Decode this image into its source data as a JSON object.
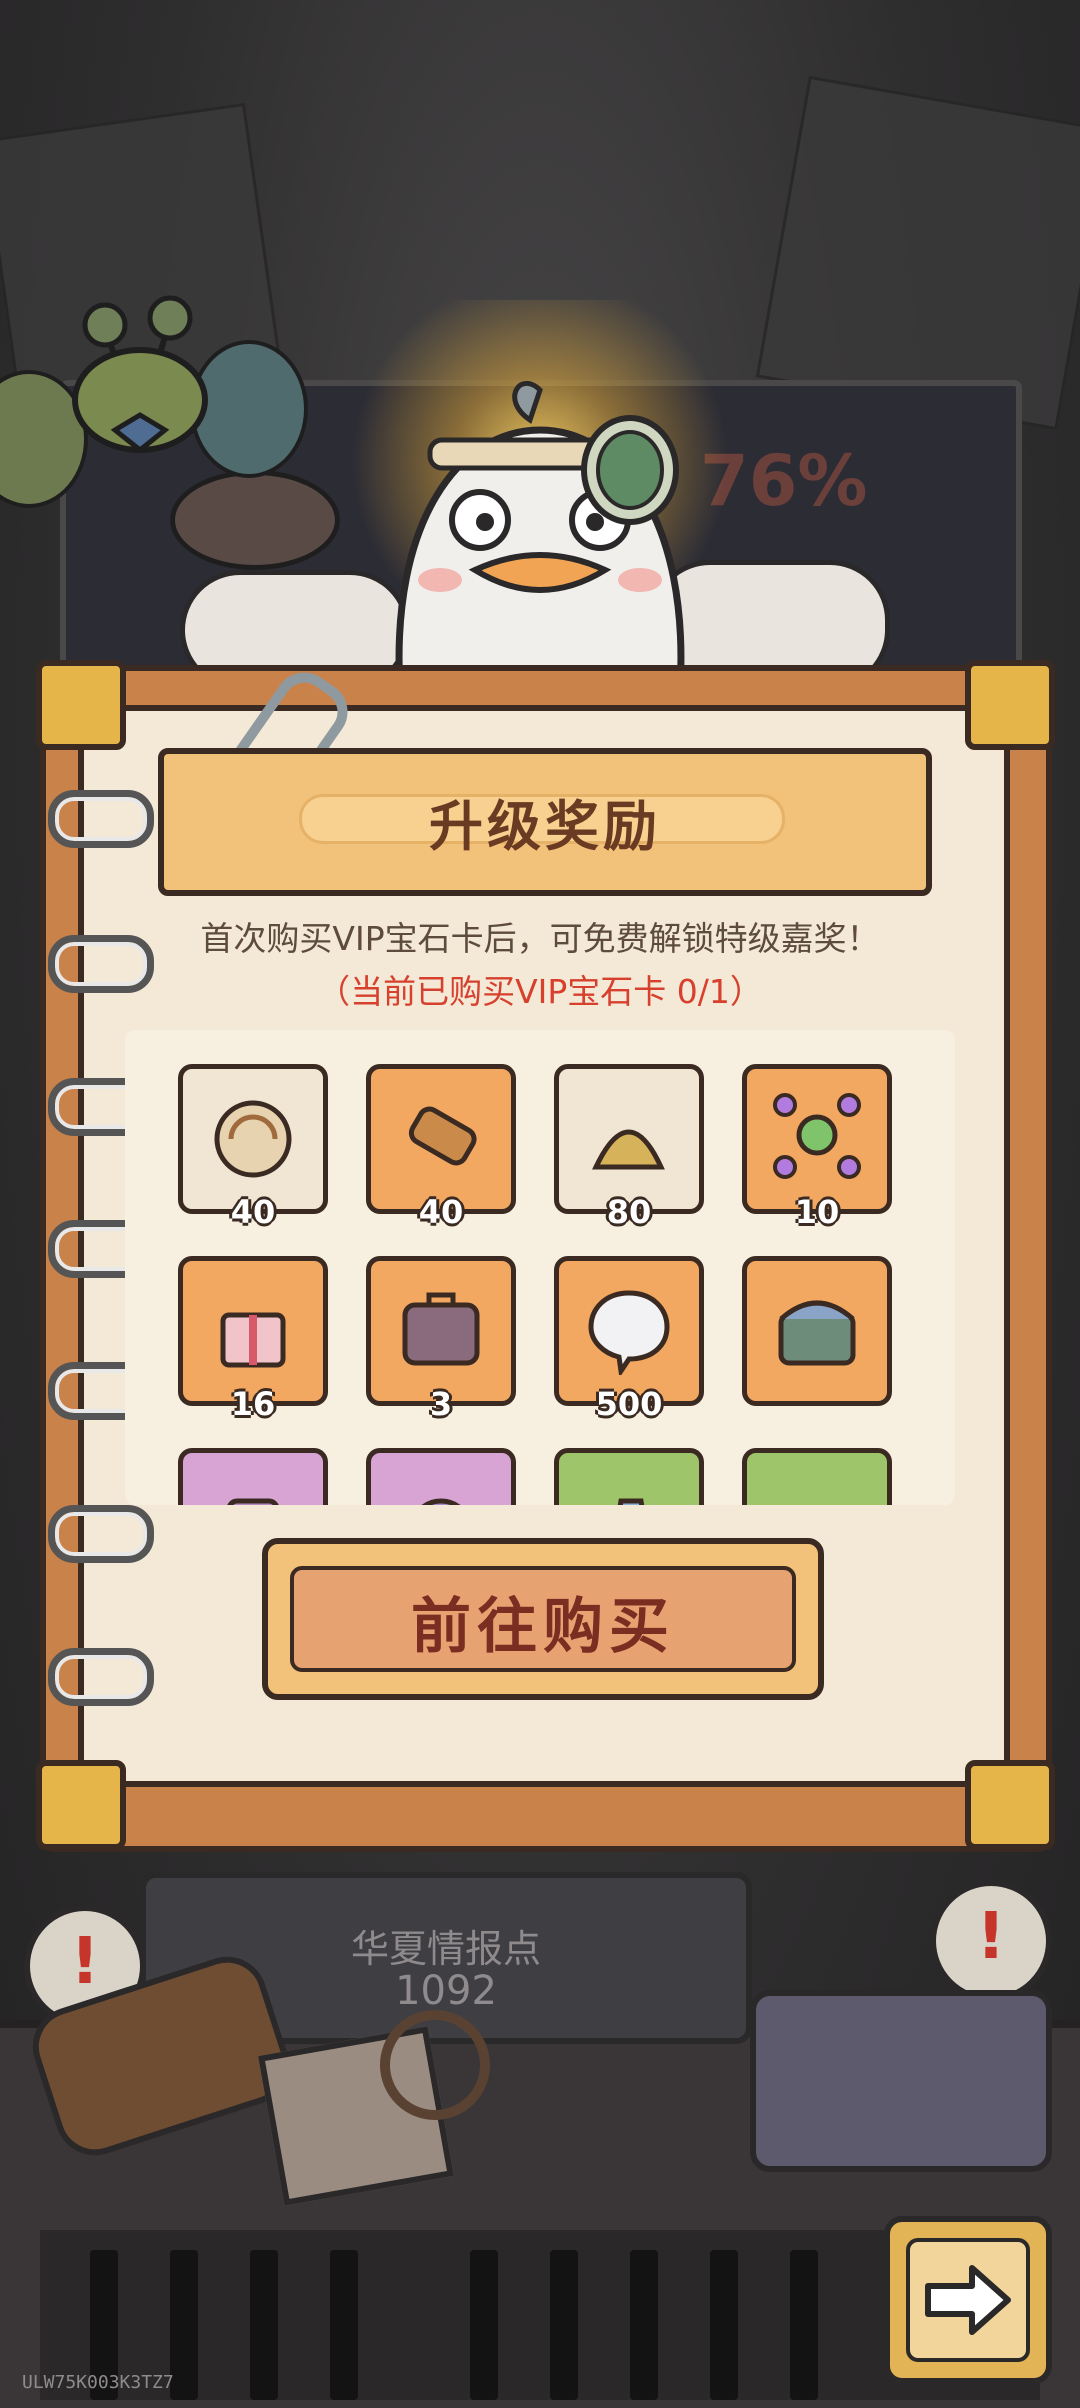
{
  "panel": {
    "title": "升级奖励",
    "description": "首次购买VIP宝石卡后，可免费解锁特级嘉奖！",
    "purchase_status": "（当前已购买VIP宝石卡 0/1）"
  },
  "rewards": [
    {
      "icon": "fossil-shell-icon",
      "quantity": "40",
      "bg": "light"
    },
    {
      "icon": "bronze-cannon-icon",
      "quantity": "40",
      "bg": "orange"
    },
    {
      "icon": "golden-claw-icon",
      "quantity": "80",
      "bg": "light"
    },
    {
      "icon": "molecule-gem-icon",
      "quantity": "10",
      "bg": "orange"
    },
    {
      "icon": "gift-box-icon",
      "quantity": "16",
      "bg": "orange"
    },
    {
      "icon": "suitcase-icon",
      "quantity": "3",
      "bg": "orange"
    },
    {
      "icon": "speech-bubble-icon",
      "quantity": "500",
      "bg": "orange"
    },
    {
      "icon": "treasure-chest-icon",
      "quantity": "",
      "bg": "orange"
    },
    {
      "icon": "lantern-icon",
      "quantity": "",
      "bg": "pink"
    },
    {
      "icon": "orb-icon",
      "quantity": "",
      "bg": "pink"
    },
    {
      "icon": "crystal-icon",
      "quantity": "",
      "bg": "green"
    },
    {
      "icon": "book-icon",
      "quantity": "",
      "bg": "green"
    }
  ],
  "buy_button": {
    "label": "前往购买"
  },
  "intel": {
    "label": "华夏情报点",
    "value": "1092"
  },
  "background_sign": "76%",
  "watermark": "ULW75K003K3TZ7",
  "colors": {
    "accent_orange": "#f3a862",
    "status_red": "#d8402e",
    "frame": "#c9824a"
  }
}
